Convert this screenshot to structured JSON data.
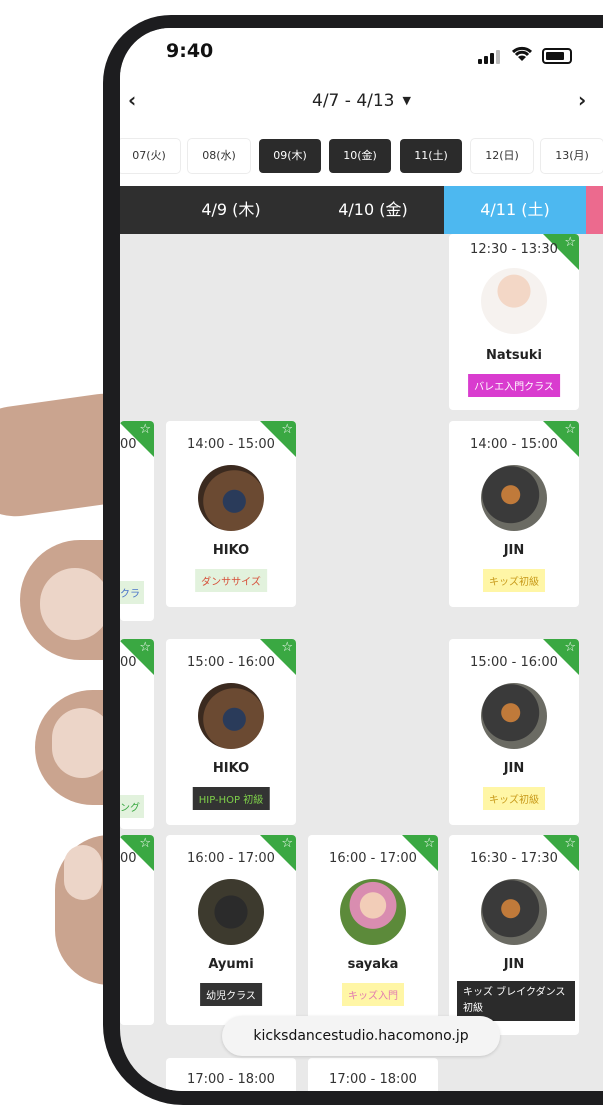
{
  "status": {
    "time": "9:40"
  },
  "week": {
    "prev": "‹",
    "next": "›",
    "range": "4/7 - 4/13",
    "caret": "▼"
  },
  "days": [
    "07(火)",
    "08(水)",
    "09(木)",
    "10(金)",
    "11(土)",
    "12(日)",
    "13(月)"
  ],
  "day_headers": [
    "4/9 (木)",
    "4/10 (金)",
    "4/11 (土)"
  ],
  "cards": [
    {
      "time": "12:30 - 13:30",
      "name": "Natsuki",
      "tag": "バレエ入門クラス"
    },
    {
      "time": "14:00 - 15:00",
      "name": "HIKO",
      "tag": "ダンササイズ"
    },
    {
      "time": "14:00 - 15:00",
      "name": "JIN",
      "tag": "キッズ初級"
    },
    {
      "time": "15:00 - 16:00",
      "name": "HIKO",
      "tag": "HIP-HOP 初級"
    },
    {
      "time": "15:00 - 16:00",
      "name": "JIN",
      "tag": "キッズ初級"
    },
    {
      "time": "16:00 - 17:00",
      "name": "Ayumi",
      "tag": "幼児クラス"
    },
    {
      "time": "16:00 - 17:00",
      "name": "sayaka",
      "tag": "キッズ入門"
    },
    {
      "time": "16:30 - 17:30",
      "name": "JIN",
      "tag": "キッズ ブレイクダンス初級"
    },
    {
      "time": "17:00 - 18:00"
    },
    {
      "time": "17:00 - 18:00"
    }
  ],
  "partial": {
    "t1": "00",
    "t2": "00",
    "t3": "00",
    "tag1": "クラ",
    "tag2": "ング"
  },
  "url": "kicksdancestudio.hacomono.jp",
  "colors": {
    "today": "#4db8f0",
    "favorite": "#3aa842",
    "header": "#2f2f2f"
  }
}
